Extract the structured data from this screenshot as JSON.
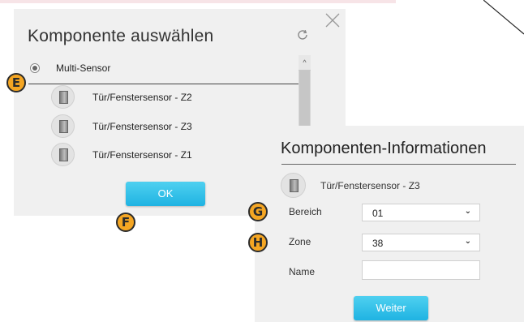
{
  "dialog1": {
    "title": "Komponente auswählen",
    "group_label": "Multi-Sensor",
    "items": [
      {
        "label": "Tür/Fenstersensor - Z2"
      },
      {
        "label": "Tür/Fenstersensor - Z3"
      },
      {
        "label": "Tür/Fenstersensor - Z1"
      }
    ],
    "ok_label": "OK"
  },
  "dialog2": {
    "title": "Komponenten-Informationen",
    "component_label": "Tür/Fenstersensor - Z3",
    "fields": {
      "bereich_label": "Bereich",
      "bereich_value": "01",
      "zone_label": "Zone",
      "zone_value": "38",
      "name_label": "Name",
      "name_value": ""
    },
    "weiter_label": "Weiter"
  },
  "markers": {
    "e": "E",
    "f": "F",
    "g": "G",
    "h": "H"
  },
  "colors": {
    "dialog_bg": "#f0f0f0",
    "button_accent": "#1fb3e2",
    "marker_fill": "#f5a623"
  }
}
